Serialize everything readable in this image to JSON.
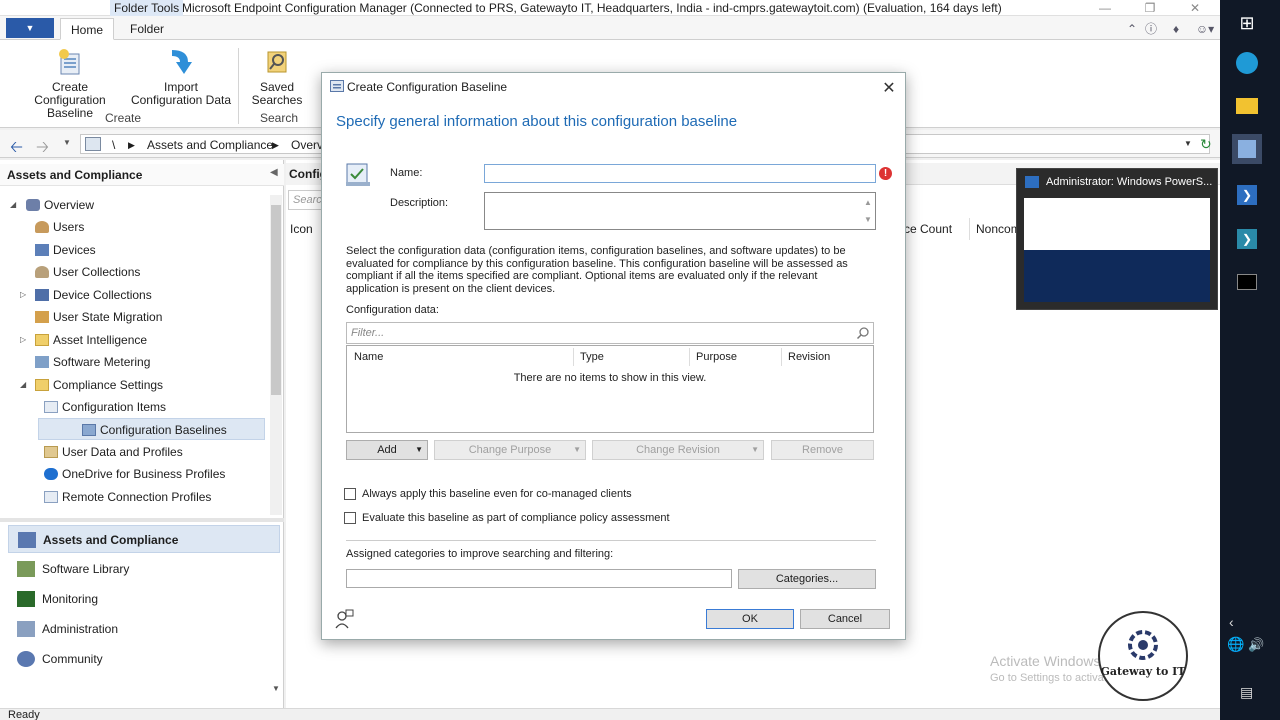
{
  "window": {
    "folder_tools": "Folder Tools",
    "title": "Microsoft Endpoint Configuration Manager (Connected to PRS, Gatewayto IT, Headquarters, India - ind-cmprs.gatewaytoit.com) (Evaluation, 164 days left)"
  },
  "tabs": {
    "home": "Home",
    "folder": "Folder"
  },
  "ribbon": {
    "create_baseline": "Create\nConfiguration Baseline",
    "create_baseline_l1": "Create",
    "create_baseline_l2": "Configuration Baseline",
    "import_l1": "Import",
    "import_l2": "Configuration Data",
    "saved_l1": "Saved",
    "saved_l2": "Searches",
    "group_create": "Create",
    "group_search": "Search"
  },
  "address": {
    "root": "\\",
    "crumb1": "Assets and Compliance",
    "crumb2": "Overv"
  },
  "nav": {
    "header": "Assets and Compliance",
    "items": [
      {
        "label": "Overview"
      },
      {
        "label": "Users"
      },
      {
        "label": "Devices"
      },
      {
        "label": "User Collections"
      },
      {
        "label": "Device Collections"
      },
      {
        "label": "User State Migration"
      },
      {
        "label": "Asset Intelligence"
      },
      {
        "label": "Software Metering"
      },
      {
        "label": "Compliance Settings"
      },
      {
        "label": "Configuration Items"
      },
      {
        "label": "Configuration Baselines"
      },
      {
        "label": "User Data and Profiles"
      },
      {
        "label": "OneDrive for Business Profiles"
      },
      {
        "label": "Remote Connection Profiles"
      }
    ],
    "workspaces": [
      {
        "label": "Assets and Compliance"
      },
      {
        "label": "Software Library"
      },
      {
        "label": "Monitoring"
      },
      {
        "label": "Administration"
      },
      {
        "label": "Community"
      }
    ]
  },
  "content": {
    "tab": "Config",
    "search_placeholder": "Search",
    "columns": {
      "icon": "Icon",
      "count": "ce Count",
      "noncompliant": "Noncom"
    }
  },
  "status": {
    "text": "Ready"
  },
  "watermark": {
    "title": "Activate Windows",
    "subtitle": "Go to Settings to activate"
  },
  "taskbar": {
    "preview_title": "Administrator: Windows PowerS..."
  },
  "dialog": {
    "title": "Create Configuration Baseline",
    "heading": "Specify general information about this configuration baseline",
    "name_label": "Name:",
    "name_value": "",
    "description_label": "Description:",
    "info": "Select the configuration data (configuration items, configuration baselines, and software updates) to be evaluated for compliance by this configuration baseline. This configuration baseline will be assessed as compliant if all the items specified are compliant. Optional items are evaluated only if the relevant application is present on the client devices.",
    "config_data_label": "Configuration data:",
    "filter_placeholder": "Filter...",
    "grid_columns": {
      "name": "Name",
      "type": "Type",
      "purpose": "Purpose",
      "revision": "Revision"
    },
    "empty_message": "There are no items to show in this view.",
    "buttons": {
      "add": "Add",
      "change_purpose": "Change Purpose",
      "change_revision": "Change Revision",
      "remove": "Remove",
      "categories": "Categories...",
      "ok": "OK",
      "cancel": "Cancel"
    },
    "check_always_apply": "Always apply this baseline even for co-managed clients",
    "check_evaluate": "Evaluate this baseline as part of compliance policy assessment",
    "categories_label": "Assigned categories to improve searching and filtering:"
  },
  "logo": {
    "text": "Gateway to IT"
  },
  "colors": {
    "accent": "#1f6bb5",
    "selection": "#dde7f3",
    "taskbar": "#101826"
  }
}
